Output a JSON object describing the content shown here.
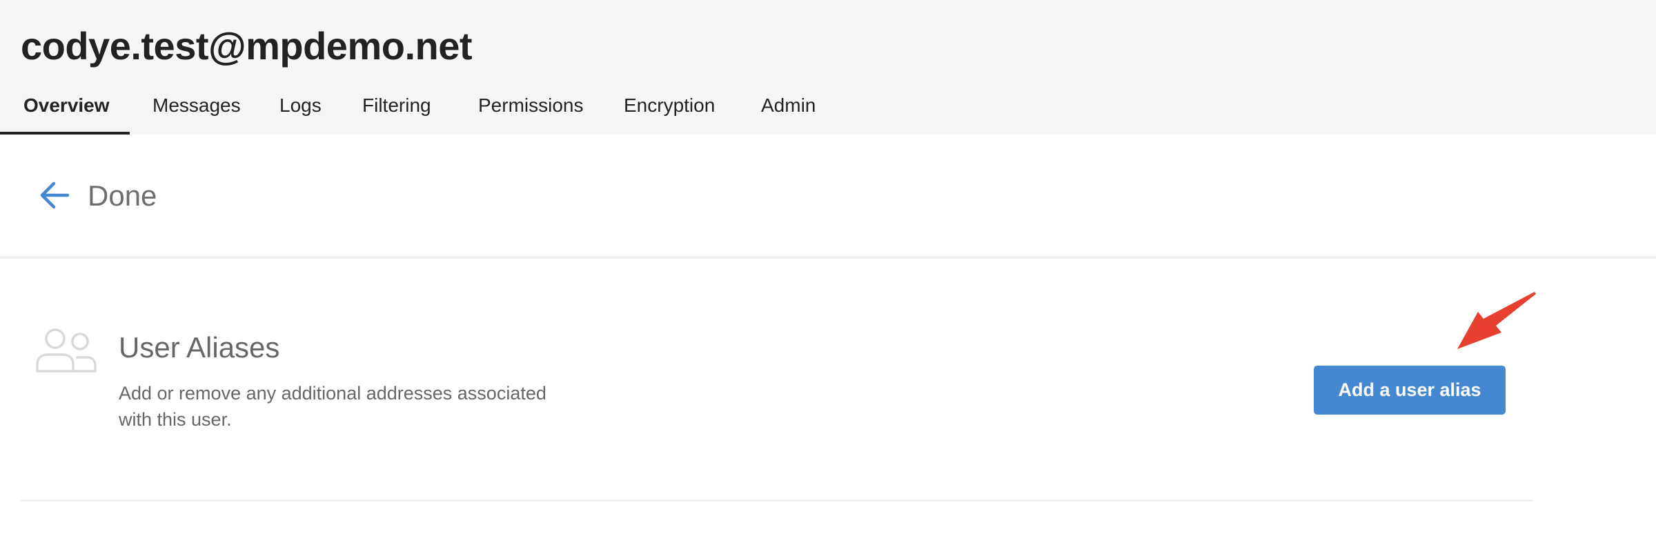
{
  "header": {
    "account_email": "codye.test@mpdemo.net",
    "tabs": [
      {
        "label": "Overview",
        "active": true
      },
      {
        "label": "Messages",
        "active": false
      },
      {
        "label": "Logs",
        "active": false
      },
      {
        "label": "Filtering",
        "active": false
      },
      {
        "label": "Permissions",
        "active": false
      },
      {
        "label": "Encryption",
        "active": false
      },
      {
        "label": "Admin",
        "active": false
      }
    ]
  },
  "toolbar": {
    "back_icon": "arrow-left-icon",
    "done_label": "Done"
  },
  "aliases_section": {
    "icon": "users-icon",
    "title": "User Aliases",
    "description": "Add or remove any additional addresses associated with this user.",
    "add_button_label": "Add a user alias"
  },
  "annotation": {
    "icon": "red-pointer-arrow",
    "color": "#e8402f"
  },
  "colors": {
    "accent": "#4488d1",
    "header_bg": "#f6f6f6"
  }
}
